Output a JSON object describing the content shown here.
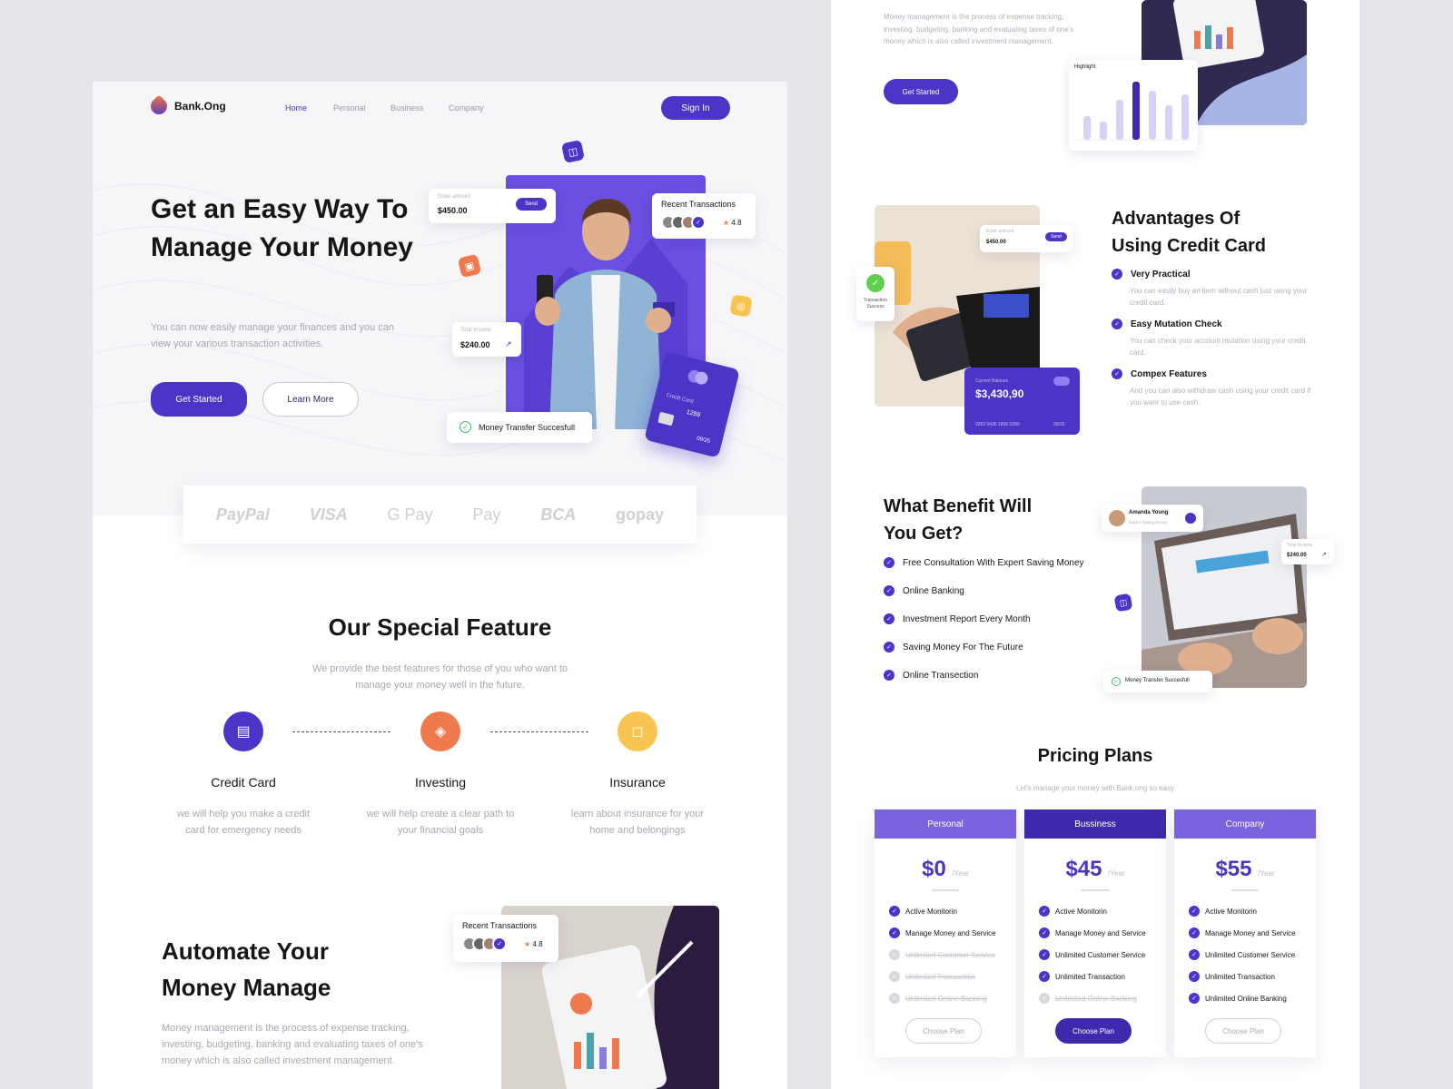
{
  "brand": {
    "name": "Bank.Ong"
  },
  "nav": {
    "items": [
      {
        "label": "Home"
      },
      {
        "label": "Personal"
      },
      {
        "label": "Business"
      },
      {
        "label": "Company"
      }
    ],
    "signin": "Sign In"
  },
  "hero": {
    "title": "Get an Easy Way To Manage Your Money",
    "subtitle": "You can now easily manage your finances and you can view your various transaction activities.",
    "cta_primary": "Get Started",
    "cta_secondary": "Learn More"
  },
  "hero_widgets": {
    "enter_amount_label": "Enter amount",
    "enter_amount_value": "$450.00",
    "send_label": "Send",
    "recent_title": "Recent Transactions",
    "rating": "4.8",
    "income_label": "Total Income",
    "income_value": "$240.00",
    "transfer_msg": "Money Transfer Succesfull",
    "card_label": "Credit Card",
    "card_last": "1289",
    "card_exp": "09/25"
  },
  "payments": [
    "PayPal",
    "VISA",
    "G Pay",
    "Pay",
    "BCA",
    "gopay"
  ],
  "feature": {
    "title": "Our Special Feature",
    "subtitle": "We provide the best features for those of you who want to manage your money well in the future.",
    "items": [
      {
        "title": "Credit Card",
        "desc": "we will help you make a credit card for emergency needs",
        "color": "#4a35c6"
      },
      {
        "title": "Investing",
        "desc": "we will help create a clear path to your financial goals",
        "color": "#ef7a4d"
      },
      {
        "title": "Insurance",
        "desc": "learn about insurance for your home and belongings",
        "color": "#f8c553"
      }
    ]
  },
  "automate": {
    "title": "Automate Your Money Manage",
    "desc": "Money management is the process of expense tracking, investing, budgeting, banking and evaluating taxes of one's money which is also called investment management.",
    "recent_title": "Recent Transactions",
    "rating": "4.8"
  },
  "right_top": {
    "desc": "Money management is the process of expense tracking, investing, budgeting, banking and evaluating taxes of one's money which is also called investment management.",
    "cta": "Get Started",
    "highlight": "Highlight"
  },
  "advantages": {
    "title": "Advantages Of Using Credit Card",
    "items": [
      {
        "title": "Very Practical",
        "desc": "You can easily buy an item without cash just using your credit card."
      },
      {
        "title": "Easy Mutation Check",
        "desc": "You can check your account mutation using your credit card."
      },
      {
        "title": "Compex Features",
        "desc": "And you can also withdraw cash using your credit card if you want to use cash."
      }
    ],
    "tx_success": "Transaction Success",
    "enter_amount_label": "Enter amount",
    "enter_amount_value": "$450.00",
    "send_label": "Send",
    "balance_label": "Current Balance",
    "balance_value": "$3,430,90",
    "card_number": "9282 0436 1890 9289",
    "card_exp": "09/25"
  },
  "benefit": {
    "title": "What Benefit Will You Get?",
    "items": [
      "Free Consultation With Expert Saving Money",
      "Online Banking",
      "Investment Report Every Month",
      "Saving Money For The Future",
      "Online Transection"
    ],
    "expert_name": "Amanda Young",
    "expert_role": "Expert Saving Money",
    "income_label": "Total Income",
    "income_value": "$240.00",
    "transfer_msg": "Money Transfer Succesfull"
  },
  "pricing": {
    "title": "Pricing Plans",
    "subtitle": "Let's manage your money with Bank.ong so easy",
    "per": "/Year",
    "features": [
      "Active Monitorin",
      "Manage Money and Service",
      "Unlimited Customer Service",
      "Unlimited Transaction",
      "Unlimited Online Banking"
    ],
    "button": "Choose Plan",
    "plans": [
      {
        "name": "Personal",
        "price": "$0",
        "enabled": [
          true,
          true,
          false,
          false,
          false
        ]
      },
      {
        "name": "Bussiness",
        "price": "$45",
        "enabled": [
          true,
          true,
          true,
          true,
          false
        ]
      },
      {
        "name": "Company",
        "price": "$55",
        "enabled": [
          true,
          true,
          true,
          true,
          true
        ]
      }
    ]
  }
}
